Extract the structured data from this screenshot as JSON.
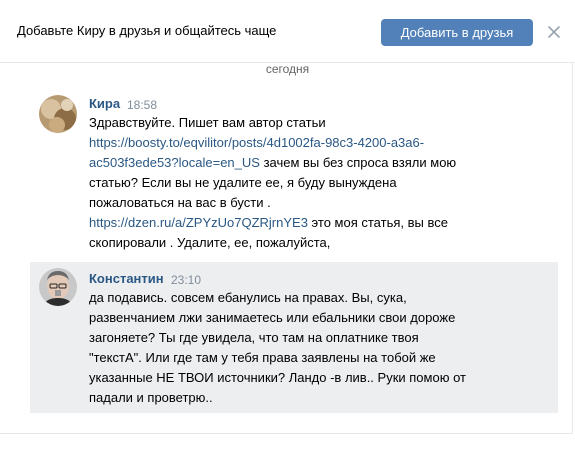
{
  "banner": {
    "text": "Добавьте Киру в друзья и общайтесь чаще",
    "add_button": "Добавить в друзья",
    "close_icon": "close-icon"
  },
  "date_separator": "сегодня",
  "messages": [
    {
      "author": "Кира",
      "time": "18:58",
      "lines": [
        [
          {
            "t": "Здравствуйте. Пишет вам автор статьи",
            "link": false
          }
        ],
        [
          {
            "t": "https://boosty.to/eqvilitor/posts/4d1002fa-98c3-4200-a3a6-",
            "link": true
          }
        ],
        [
          {
            "t": "ac503f3ede53?locale=en_US",
            "link": true
          },
          {
            "t": " зачем вы без спроса взяли мою",
            "link": false
          }
        ],
        [
          {
            "t": "статью? Если вы не удалите ее, я буду вынуждена",
            "link": false
          }
        ],
        [
          {
            "t": "пожаловаться на вас в бусти .",
            "link": false
          }
        ],
        [
          {
            "t": "https://dzen.ru/a/ZPYzUo7QZRjrnYE3",
            "link": true
          },
          {
            "t": " это моя статья, вы все",
            "link": false
          }
        ],
        [
          {
            "t": "скопировали . Удалите, ее, пожалуйста,",
            "link": false
          }
        ]
      ]
    },
    {
      "author": "Константин",
      "time": "23:10",
      "lines": [
        [
          {
            "t": "да подавись. совсем ебанулись на правах. Вы, сука,",
            "link": false
          }
        ],
        [
          {
            "t": "развенчанием лжи занимаетесь или ебальники свои дороже",
            "link": false
          }
        ],
        [
          {
            "t": "загоняете? Ты где увидела, что там на оплатнике твоя",
            "link": false
          }
        ],
        [
          {
            "t": "\"текстА\". Или где там у тебя права заявлены на тобой же",
            "link": false
          }
        ],
        [
          {
            "t": "указанные НЕ ТВОИ источники? Ландо -в лив.. Руки помою от",
            "link": false
          }
        ],
        [
          {
            "t": "падали и проветрю..",
            "link": false
          }
        ]
      ]
    }
  ],
  "colors": {
    "accent": "#5181b8",
    "link": "#2a5885",
    "highlight_bg": "#edeef0"
  }
}
